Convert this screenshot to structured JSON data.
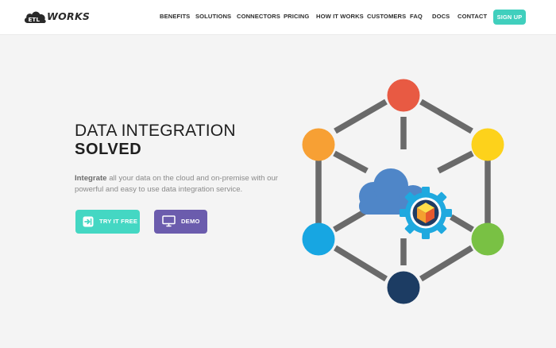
{
  "header": {
    "logo": {
      "badge_text": "ETL",
      "word": "WORKS"
    },
    "nav": [
      "BENEFITS",
      "SOLUTIONS",
      "CONNECTORS",
      "PRICING",
      "HOW IT WORKS",
      "CUSTOMERS",
      "FAQ",
      "DOCS",
      "CONTACT"
    ],
    "signup_label": "SIGN UP"
  },
  "hero": {
    "title_line1": "DATA INTEGRATION",
    "title_line2": "SOLVED",
    "description_bold": "Integrate",
    "description_rest": " all your data on the cloud and on-premise with our powerful and easy to use data integration service.",
    "try_label": "TRY IT FREE",
    "demo_label": "DEMO"
  },
  "colors": {
    "accent_teal": "#40cfbd",
    "demo_purple": "#6b5cad",
    "node_red": "#e85a43",
    "node_orange": "#f7a034",
    "node_yellow": "#fdd21b",
    "node_blue": "#17a6e2",
    "node_green": "#79c144",
    "node_navy": "#1c3c63",
    "cloud_blue": "#4f86c8",
    "gear_blue": "#1fa9df",
    "connector_gray": "#6a6a6a"
  },
  "icons": {
    "logo": "cloud-logo-icon",
    "try": "sign-in-arrow-icon",
    "demo": "monitor-icon",
    "center": "cloud-gear-icon"
  }
}
